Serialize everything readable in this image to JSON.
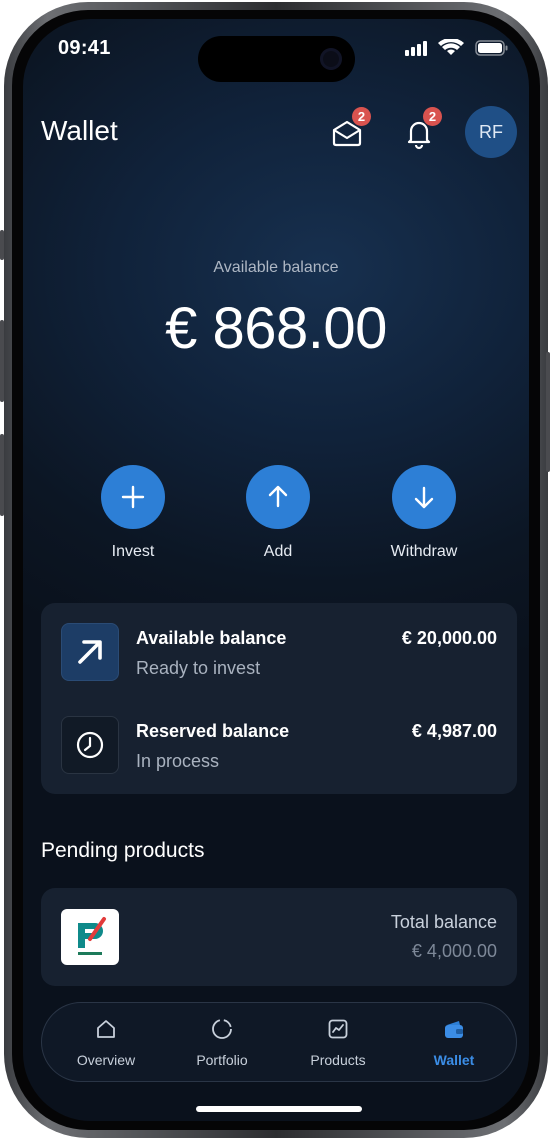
{
  "status_bar": {
    "time": "09:41"
  },
  "header": {
    "title": "Wallet",
    "messages_badge": "2",
    "notifications_badge": "2",
    "avatar_initials": "RF"
  },
  "balance": {
    "label": "Available balance",
    "amount": "€ 868.00"
  },
  "actions": [
    {
      "label": "Invest",
      "icon": "plus-icon"
    },
    {
      "label": "Add",
      "icon": "arrow-up-icon"
    },
    {
      "label": "Withdraw",
      "icon": "arrow-down-icon"
    }
  ],
  "balances_card": {
    "rows": [
      {
        "title": "Available balance",
        "subtitle": "Ready to invest",
        "amount": "€ 20,000.00",
        "icon": "arrow-up-right-icon"
      },
      {
        "title": "Reserved balance",
        "subtitle": "In process",
        "amount": "€ 4,987.00",
        "icon": "clock-icon"
      }
    ]
  },
  "pending": {
    "section_title": "Pending products",
    "product": {
      "total_label": "Total balance",
      "total_amount": "€ 4,000.00",
      "logo": "product-logo"
    }
  },
  "nav": {
    "items": [
      {
        "label": "Overview",
        "icon": "home-icon",
        "active": false
      },
      {
        "label": "Portfolio",
        "icon": "circle-chart-icon",
        "active": false
      },
      {
        "label": "Products",
        "icon": "chart-icon",
        "active": false
      },
      {
        "label": "Wallet",
        "icon": "wallet-icon",
        "active": true
      }
    ]
  },
  "colors": {
    "accent": "#2d7fd6",
    "badge": "#d9534f",
    "card": "#172130",
    "nav_active": "#3b8de6"
  }
}
